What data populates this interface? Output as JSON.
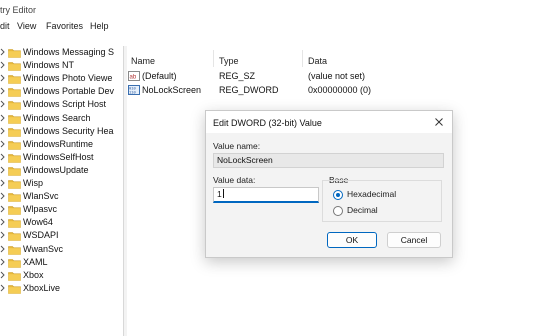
{
  "window": {
    "title": "try Editor"
  },
  "menu": [
    "dit",
    "View",
    "Favorites",
    "Help"
  ],
  "tree": {
    "items": [
      "Windows Messaging S",
      "Windows NT",
      "Windows Photo Viewe",
      "Windows Portable Dev",
      "Windows Script Host",
      "Windows Search",
      "Windows Security Hea",
      "WindowsRuntime",
      "WindowsSelfHost",
      "WindowsUpdate",
      "Wisp",
      "WlanSvc",
      "Wlpasvc",
      "Wow64",
      "WSDAPI",
      "WwanSvc",
      "XAML",
      "Xbox",
      "XboxLive"
    ]
  },
  "values": {
    "headers": {
      "name": "Name",
      "type": "Type",
      "data": "Data"
    },
    "rows": [
      {
        "icon": "string-value-icon",
        "name": "(Default)",
        "type": "REG_SZ",
        "data": "(value not set)"
      },
      {
        "icon": "binary-value-icon",
        "name": "NoLockScreen",
        "type": "REG_DWORD",
        "data": "0x00000000 (0)"
      }
    ]
  },
  "dialog": {
    "title": "Edit DWORD (32-bit) Value",
    "value_name_label": "Value name:",
    "value_name": "NoLockScreen",
    "value_data_label": "Value data:",
    "value_data": "1",
    "base_label": "Base",
    "base_options": [
      {
        "label": "Hexadecimal",
        "selected": true
      },
      {
        "label": "Decimal",
        "selected": false
      }
    ],
    "ok_label": "OK",
    "cancel_label": "Cancel"
  },
  "colors": {
    "folder": "#e8b93a",
    "accent": "#0067c0"
  }
}
